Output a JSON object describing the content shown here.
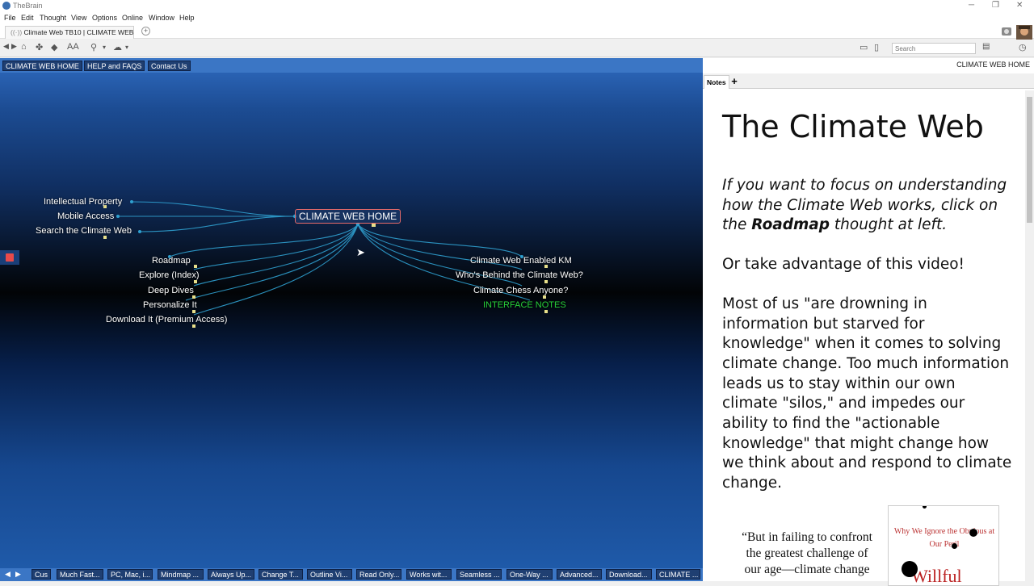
{
  "window": {
    "title": "TheBrain",
    "minimize": "─",
    "restore": "❐",
    "close": "✕"
  },
  "menu": [
    "File",
    "Edit",
    "Thought",
    "View",
    "Options",
    "Online",
    "Window",
    "Help"
  ],
  "tab": {
    "label": "Climate Web TB10 | CLIMATE WEB H...",
    "add": "+"
  },
  "toolbar": {
    "search_placeholder": "Search",
    "font_label": "AA"
  },
  "breadcrumbs": [
    "CLIMATE WEB HOME",
    "HELP and FAQS",
    "Contact Us"
  ],
  "plex": {
    "central": "CLIMATE WEB HOME",
    "parents": [
      "Intellectual Property",
      "Mobile Access",
      "Search the Climate Web"
    ],
    "children_left": [
      "Roadmap",
      "Explore (Index)",
      "Deep Dives",
      "Personalize It",
      "Download It (Premium Access)"
    ],
    "children_right": [
      "Climate Web Enabled KM",
      "Who's Behind the Climate Web?",
      "Climate Chess Anyone?",
      "INTERFACE NOTES"
    ]
  },
  "bottom_tabs": [
    "Cus",
    "Much Fast...",
    "PC, Mac, i...",
    "Mindmap ...",
    "Always Up...",
    "Change T...",
    "Outline Vi...",
    "Read Only...",
    "Works wit...",
    "Seamless ...",
    "One-Way ...",
    "Advanced...",
    "Download...",
    "CLIMATE ..."
  ],
  "right_panel": {
    "crumb": "CLIMATE WEB HOME",
    "tab_notes": "Notes",
    "tab_add": "+",
    "title": "The Climate Web",
    "p1_a": "If you want to focus on understanding how the Climate Web works, click on the ",
    "p1_bold": "Roadmap",
    "p1_b": " thought at left.",
    "p2": "Or take advantage of this video!",
    "p3": "Most of us \"are drowning in information but starved for knowledge\" when it comes to solving climate change. Too much information leads us to stay within our own climate \"silos,\" and impedes our ability to find the \"actionable knowledge\" that might change how we think about and respond to climate change.",
    "quote": "“But in failing to confront the greatest challenge of our age—climate change",
    "book_subtitle": "Why We Ignore the Obvious at Our Peril",
    "book_title": "Willful"
  },
  "colors": {
    "accent": "#3b76c5",
    "central_border": "#e56a6a",
    "green_node": "#27d23a"
  }
}
